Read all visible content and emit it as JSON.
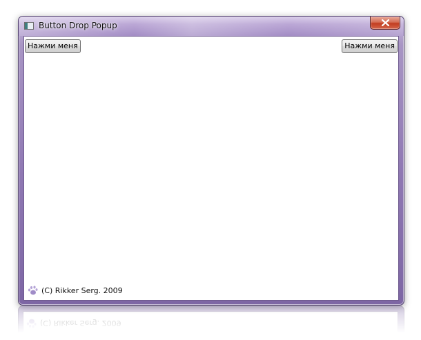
{
  "window": {
    "title": "Button Drop Popup",
    "icon": "window-app-icon",
    "close_icon": "close-x-icon"
  },
  "buttons": {
    "left_label": "Нажми меня",
    "right_label": "Нажми меня"
  },
  "status": {
    "icon": "paw-print-icon",
    "text": "(C) Rikker Serg. 2009"
  },
  "colors": {
    "frame_accent": "#8f78b3",
    "close_button": "#c23d21",
    "client_background": "#ffffff",
    "paw_icon": "#a08cc8"
  }
}
